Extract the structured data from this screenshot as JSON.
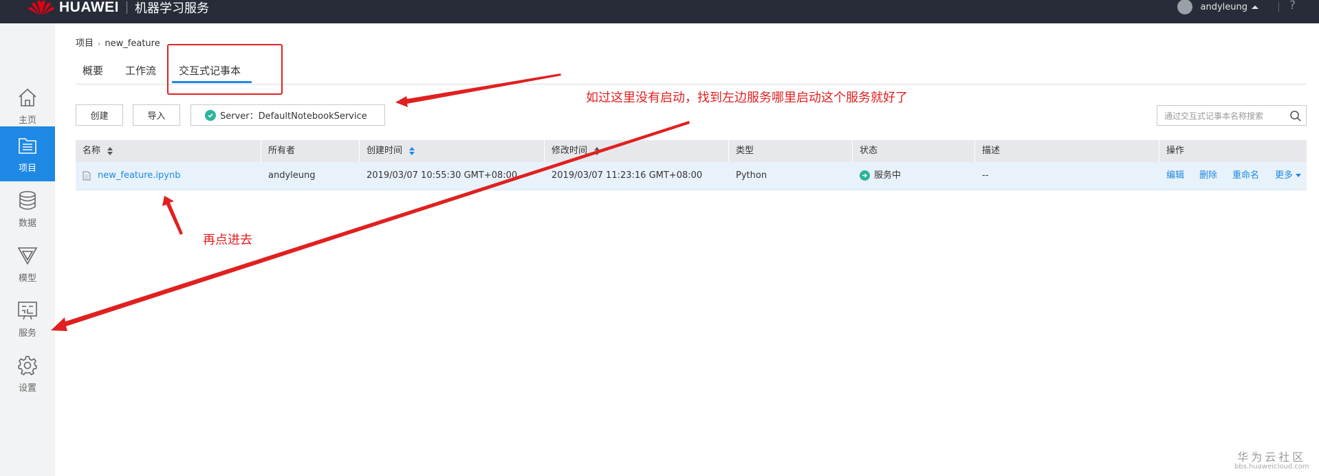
{
  "header": {
    "brand": "HUAWEI",
    "app_title": "机器学习服务",
    "username": "andyleung",
    "help_label": "?"
  },
  "sidebar": {
    "items": [
      {
        "label": "主页",
        "icon": "home-icon",
        "active": false
      },
      {
        "label": "项目",
        "icon": "project-icon",
        "active": true
      },
      {
        "label": "数据",
        "icon": "database-icon",
        "active": false
      },
      {
        "label": "模型",
        "icon": "model-icon",
        "active": false
      },
      {
        "label": "服务",
        "icon": "service-icon",
        "active": false
      },
      {
        "label": "设置",
        "icon": "gear-icon",
        "active": false
      }
    ]
  },
  "breadcrumb": {
    "root": "项目",
    "separator": "›",
    "current": "new_feature"
  },
  "tabs": [
    {
      "label": "概要"
    },
    {
      "label": "工作流"
    },
    {
      "label": "交互式记事本",
      "active": true
    }
  ],
  "toolbar": {
    "create_label": "创建",
    "import_label": "导入",
    "server_label": "Server：DefaultNotebookService",
    "search_placeholder": "通过交互式记事本名称搜索"
  },
  "table": {
    "columns": [
      "名称",
      "所有者",
      "创建时间",
      "修改时间",
      "类型",
      "状态",
      "描述",
      "操作"
    ],
    "rows": [
      {
        "name": "new_feature.ipynb",
        "owner": "andyleung",
        "created": "2019/03/07 10:55:30 GMT+08:00",
        "modified": "2019/03/07 11:23:16 GMT+08:00",
        "type": "Python",
        "status": "服务中",
        "description": "--",
        "actions": {
          "edit": "编辑",
          "delete": "删除",
          "rename": "重命名",
          "more": "更多"
        }
      }
    ]
  },
  "annotations": {
    "top_note": "如过这里没有启动，找到左边服务哪里启动这个服务就好了",
    "bottom_note": "再点进去"
  },
  "watermark": {
    "title": "华为云社区",
    "url": "bbs.huaweicloud.com"
  },
  "colors": {
    "topbar": "#272c38",
    "accent": "#1e88e5",
    "annotation": "#e02020",
    "status_ok": "#2bb59a",
    "brand_red": "#e60012"
  }
}
